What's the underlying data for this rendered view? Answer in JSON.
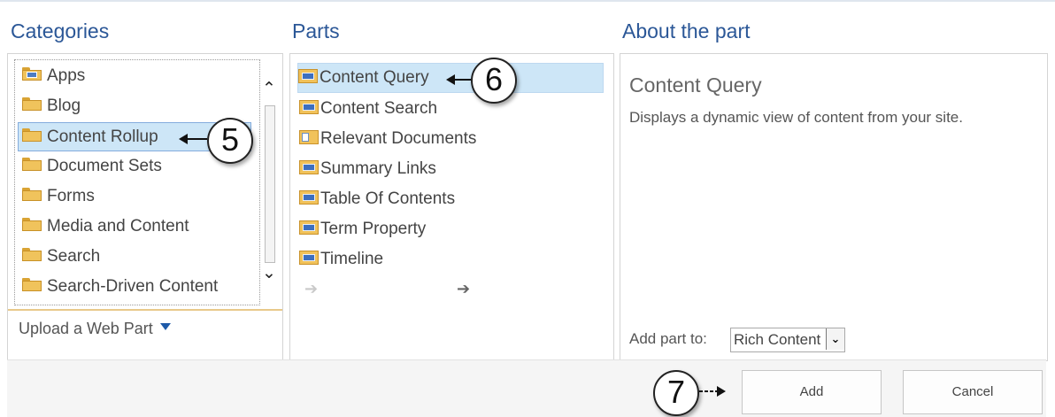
{
  "headings": {
    "categories": "Categories",
    "parts": "Parts",
    "about": "About the part"
  },
  "categories": {
    "items": [
      {
        "label": "Apps",
        "icon": "apps-folder-icon",
        "selected": false
      },
      {
        "label": "Blog",
        "icon": "folder-icon",
        "selected": false
      },
      {
        "label": "Content Rollup",
        "icon": "folder-icon",
        "selected": true
      },
      {
        "label": "Document Sets",
        "icon": "folder-icon",
        "selected": false
      },
      {
        "label": "Forms",
        "icon": "folder-icon",
        "selected": false
      },
      {
        "label": "Media and Content",
        "icon": "folder-icon",
        "selected": false
      },
      {
        "label": "Search",
        "icon": "folder-icon",
        "selected": false
      },
      {
        "label": "Search-Driven Content",
        "icon": "folder-icon",
        "selected": false
      }
    ],
    "upload_label": "Upload a Web Part"
  },
  "parts": {
    "items": [
      {
        "label": "Content Query",
        "icon": "web-part-icon",
        "selected": true
      },
      {
        "label": "Content Search",
        "icon": "web-part-icon",
        "selected": false
      },
      {
        "label": "Relevant Documents",
        "icon": "document-web-part-icon",
        "selected": false
      },
      {
        "label": "Summary Links",
        "icon": "web-part-icon",
        "selected": false
      },
      {
        "label": "Table Of Contents",
        "icon": "web-part-icon",
        "selected": false
      },
      {
        "label": "Term Property",
        "icon": "web-part-icon",
        "selected": false
      },
      {
        "label": "Timeline",
        "icon": "web-part-icon",
        "selected": false
      }
    ]
  },
  "about": {
    "title": "Content Query",
    "description": "Displays a dynamic view of content from your site.",
    "add_part_to_label": "Add part to:",
    "add_part_to_value": "Rich Content"
  },
  "buttons": {
    "add": "Add",
    "cancel": "Cancel"
  },
  "callouts": [
    "5",
    "6",
    "7"
  ],
  "colors": {
    "heading": "#2b5797",
    "selection": "#cde6f7",
    "selection_border": "#84acdd"
  }
}
